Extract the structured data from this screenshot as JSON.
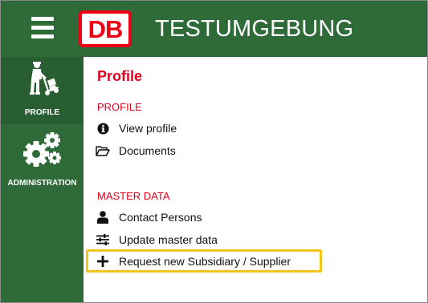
{
  "header": {
    "menu_icon": "hamburger-menu-icon",
    "logo_text": "DB",
    "title": "TESTUMGEBUNG",
    "brand_color": "#ec0016",
    "bar_color": "#2e6b38"
  },
  "sidebar": {
    "items": [
      {
        "label": "PROFILE",
        "icon": "worker-trolley-icon",
        "active": true
      },
      {
        "label": "ADMINISTRATION",
        "icon": "gears-icon",
        "active": false
      }
    ]
  },
  "main": {
    "page_title": "Profile",
    "sections": [
      {
        "title": "PROFILE",
        "items": [
          {
            "label": "View profile",
            "icon": "info-circle-icon"
          },
          {
            "label": "Documents",
            "icon": "folder-open-icon"
          }
        ]
      },
      {
        "title": "MASTER DATA",
        "items": [
          {
            "label": "Contact Persons",
            "icon": "user-icon"
          },
          {
            "label": "Update master data",
            "icon": "sliders-icon"
          },
          {
            "label": "Request new Subsidiary / Supplier",
            "icon": "plus-icon",
            "highlighted": true
          }
        ]
      }
    ],
    "accent_color": "#e2001a",
    "highlight_color": "#f2c618"
  }
}
